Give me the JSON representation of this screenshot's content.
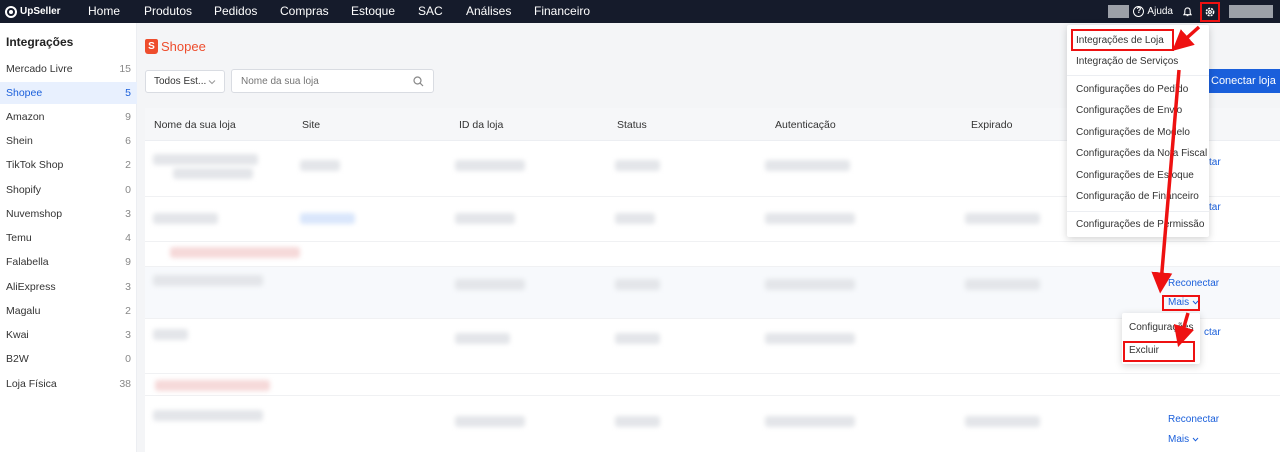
{
  "brand": {
    "name": "UpSeller"
  },
  "nav": [
    {
      "label": "Home"
    },
    {
      "label": "Produtos"
    },
    {
      "label": "Pedidos"
    },
    {
      "label": "Compras"
    },
    {
      "label": "Estoque"
    },
    {
      "label": "SAC"
    },
    {
      "label": "Análises"
    },
    {
      "label": "Financeiro"
    }
  ],
  "top_right": {
    "help_label": "Ajuda",
    "help_icon": "help-circle-icon",
    "bell_icon": "bell-icon",
    "settings_icon": "gear-icon"
  },
  "sidebar": {
    "title": "Integrações",
    "items": [
      {
        "label": "Mercado Livre",
        "count": "15"
      },
      {
        "label": "Shopee",
        "count": "5",
        "active": true
      },
      {
        "label": "Amazon",
        "count": "9"
      },
      {
        "label": "Shein",
        "count": "6"
      },
      {
        "label": "TikTok Shop",
        "count": "2"
      },
      {
        "label": "Shopify",
        "count": "0"
      },
      {
        "label": "Nuvemshop",
        "count": "3"
      },
      {
        "label": "Temu",
        "count": "4"
      },
      {
        "label": "Falabella",
        "count": "9"
      },
      {
        "label": "AliExpress",
        "count": "3"
      },
      {
        "label": "Magalu",
        "count": "2"
      },
      {
        "label": "Kwai",
        "count": "3"
      },
      {
        "label": "B2W",
        "count": "0"
      },
      {
        "label": "Loja Física",
        "count": "38"
      }
    ]
  },
  "page": {
    "title": "Shopee",
    "filter_value": "Todos Est...",
    "search_placeholder": "Nome da sua loja",
    "connect_button": "Conectar loja"
  },
  "table": {
    "columns": [
      "Nome da sua loja",
      "Site",
      "ID da loja",
      "Status",
      "Autenticação",
      "Expirado"
    ],
    "actions": {
      "reconnect": "Reconectar",
      "more": "Mais",
      "partial_ctar": "ctar"
    }
  },
  "settings_menu": {
    "items": [
      {
        "label": "Integrações de Loja"
      },
      {
        "label": "Integração de Serviços"
      },
      {
        "label": "Configurações do Pedido"
      },
      {
        "label": "Configurações de Envio"
      },
      {
        "label": "Configurações de Modelo"
      },
      {
        "label": "Configurações da Nota Fiscal"
      },
      {
        "label": "Configurações de Estoque"
      },
      {
        "label": "Configuração de Financeiro"
      },
      {
        "label": "Configurações de Permissão"
      }
    ]
  },
  "more_menu": {
    "items": [
      {
        "label": "Configurações"
      },
      {
        "label": "Excluir"
      }
    ]
  },
  "colors": {
    "topbar": "#151b2b",
    "accent": "#1a5fdb",
    "shopee": "#ee4d2d",
    "annotation": "#e11111"
  }
}
